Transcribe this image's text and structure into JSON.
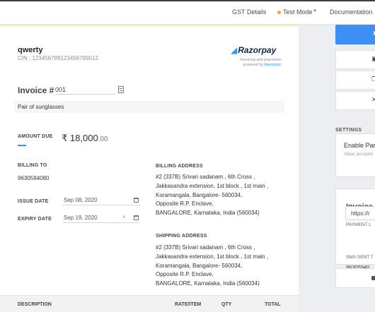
{
  "topbar": {
    "gst_details": "GST Details",
    "test_mode": "Test Mode",
    "documentation": "Documentation"
  },
  "company": {
    "name": "qwerty",
    "cin_label": "CIN :",
    "cin_value": "123456789123456789012"
  },
  "brand": {
    "logo_text": "Razorpay",
    "tagline": "Invoicing and payments",
    "powered_by": "powered by",
    "powered_name": "Razorpay"
  },
  "invoice": {
    "label": "Invoice #",
    "number": "001",
    "description": "Pair of sunglasses",
    "amount_due_label": "AMOUNT DUE",
    "currency_symbol": "₹",
    "amount_main": "18,000",
    "amount_paise": ".00",
    "billing_to_label": "BILLING TO",
    "billing_to_value": "9630594080",
    "issue_date_label": "ISSUE DATE",
    "issue_date": "Sep 08, 2020",
    "expiry_date_label": "EXPIRY DATE",
    "expiry_date": "Sep 19, 2020"
  },
  "billing_address": {
    "label": "BILLING ADDRESS",
    "lines": [
      "#2 (337B) Srivari sadanam , 6th Cross ,",
      "Jakkasandra extension, 1st block , 1st main ,",
      "Koramangala, Bangalore- 560034,",
      "Opposite R.P. Enclave,",
      "BANGALORE, Karnataka, India (560034)"
    ]
  },
  "shipping_address": {
    "label": "SHIPPING ADDRESS",
    "lines": [
      "#2 (337B) Srivari sadanam , 6th Cross ,",
      "Jakkasandra extension, 1st block , 1st main ,",
      "Koramangala, Bangalore- 560034,",
      "Opposite R.P. Enclave,",
      "BANGALORE, Karnataka, India (560034)"
    ]
  },
  "table": {
    "headers": [
      "DESCRIPTION",
      "RATE/ITEM",
      "QTY",
      "TOTAL"
    ]
  },
  "right_panel": {
    "settings_heading": "SETTINGS",
    "enable_partial": "Enable Par",
    "allow_accepting": "Allow acceptin",
    "invoice_card_title": "Invoice -",
    "payment_link_label": "PAYMENT L",
    "payment_link_value": "https://r",
    "sms_sent_label": "SMS SENT T",
    "sms_sent_value": "96305940"
  },
  "colors": {
    "accent": "#3b8ff5",
    "test_mode_dot": "#f5a623",
    "brand_dark": "#0c2451",
    "brand_light": "#3395ff"
  }
}
